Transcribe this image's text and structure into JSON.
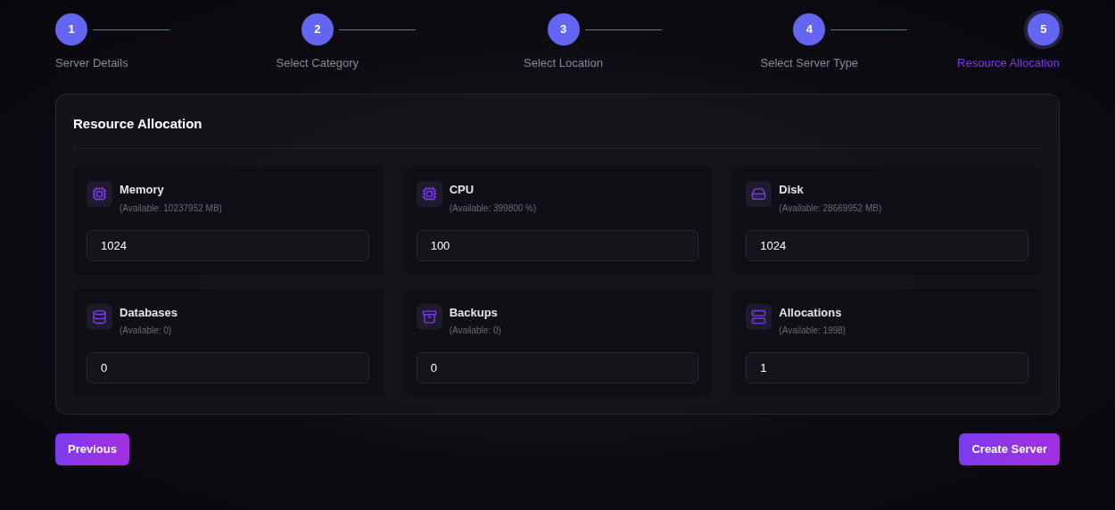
{
  "steps": [
    {
      "number": "1",
      "label": "Server Details",
      "selected": false
    },
    {
      "number": "2",
      "label": "Select Category",
      "selected": false
    },
    {
      "number": "3",
      "label": "Select Location",
      "selected": false
    },
    {
      "number": "4",
      "label": "Select Server Type",
      "selected": false
    },
    {
      "number": "5",
      "label": "Resource Allocation",
      "selected": true
    }
  ],
  "panel": {
    "title": "Resource Allocation",
    "resources": [
      {
        "kind": "chip",
        "name": "Memory",
        "available": "(Available: 10237952 MB)",
        "value": "1024"
      },
      {
        "kind": "chip",
        "name": "CPU",
        "available": "(Available: 399800 %)",
        "value": "100"
      },
      {
        "kind": "disk",
        "name": "Disk",
        "available": "(Available: 28669952 MB)",
        "value": "1024"
      },
      {
        "kind": "database",
        "name": "Databases",
        "available": "(Available: 0)",
        "value": "0"
      },
      {
        "kind": "archive",
        "name": "Backups",
        "available": "(Available: 0)",
        "value": "0"
      },
      {
        "kind": "server",
        "name": "Allocations",
        "available": "(Available: 1998)",
        "value": "1"
      }
    ]
  },
  "buttons": {
    "previous": "Previous",
    "submit": "Create Server"
  }
}
